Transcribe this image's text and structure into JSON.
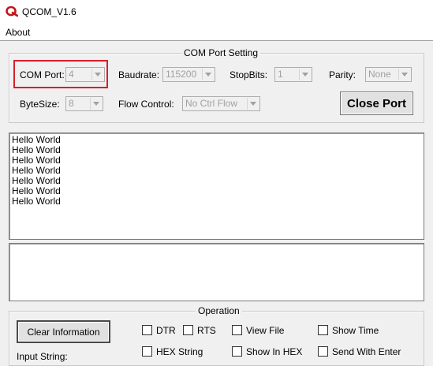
{
  "window": {
    "title": "QCOM_V1.6"
  },
  "menu": {
    "items": [
      "About"
    ]
  },
  "port_settings": {
    "group_title": "COM Port Setting",
    "com_port": {
      "label": "COM Port:",
      "value": "4"
    },
    "baudrate": {
      "label": "Baudrate:",
      "value": "115200"
    },
    "stopbits": {
      "label": "StopBits:",
      "value": "1"
    },
    "parity": {
      "label": "Parity:",
      "value": "None"
    },
    "bytesize": {
      "label": "ByteSize:",
      "value": "8"
    },
    "flow_control": {
      "label": "Flow Control:",
      "value": "No Ctrl Flow"
    },
    "close_port_label": "Close Port"
  },
  "receive": {
    "lines": [
      "Hello World",
      "Hello World",
      "Hello World",
      "Hello World",
      "Hello World",
      "Hello World",
      "Hello World"
    ]
  },
  "operation": {
    "group_title": "Operation",
    "clear_label": "Clear Information",
    "input_label": "Input String:",
    "checkboxes": {
      "dtr": "DTR",
      "rts": "RTS",
      "view_file": "View File",
      "show_time": "Show Time",
      "hex_string": "HEX String",
      "show_in_hex": "Show In HEX",
      "send_with_enter": "Send With Enter"
    }
  },
  "colors": {
    "highlight": "#d4202a",
    "disabled_text": "#a0a0a0",
    "logo": "#c0161d"
  }
}
